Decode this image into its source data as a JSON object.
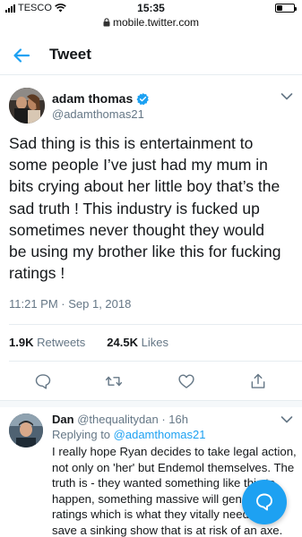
{
  "status_bar": {
    "carrier": "TESCO",
    "time": "15:35",
    "battery_level": 0.35
  },
  "url_bar": {
    "url": "mobile.twitter.com"
  },
  "header": {
    "title": "Tweet"
  },
  "tweet": {
    "name": "adam thomas",
    "handle": "@adamthomas21",
    "text": "Sad thing is this is entertainment to\nsome people I’ve just had my mum in\nbits crying about her little boy that’s the\nsad truth ! This industry is fucked up\nsometimes never thought they would\nbe using my brother like this for fucking\nratings !",
    "timestamp": "11:21 PM · Sep 1, 2018",
    "retweets_count": "1.9K",
    "retweets_label": "Retweets",
    "likes_count": "24.5K",
    "likes_label": "Likes"
  },
  "reply": {
    "name": "Dan",
    "handle": "@thequalitydan",
    "time": "· 16h",
    "replying_prefix": "Replying to",
    "replying_to": "@adamthomas21",
    "text": "I really hope Ryan decides to take legal action,\nnot only on 'her' but Endemol themselves.  The\ntruth is - they wanted something like this to\nhappen, something massive will generate\nratings which is what they vitally need to\nsave a sinking show that is at risk of an axe."
  },
  "icons": {
    "back": "arrow-left-icon",
    "verified": "verified-badge-icon",
    "caret": "chevron-down-icon",
    "reply": "comment-icon",
    "retweet": "retweet-icon",
    "like": "heart-icon",
    "share": "share-icon",
    "compose": "speech-bubble-icon"
  },
  "colors": {
    "accent": "#1da1f2",
    "text": "#14171a",
    "muted": "#657786",
    "divider": "#e6ecf0"
  }
}
